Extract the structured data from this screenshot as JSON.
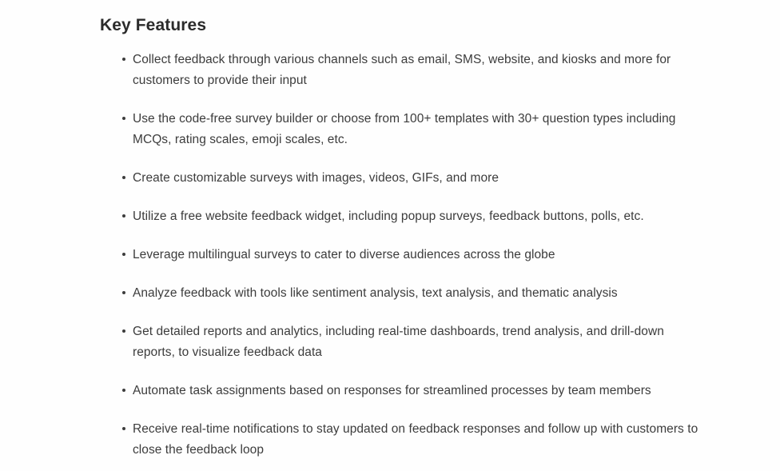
{
  "document": {
    "background_color": "#fefefe",
    "text_color": "#3c3c3c",
    "heading_color": "#2b2b2b"
  },
  "section": {
    "title": "Key Features",
    "bullet_glyph": "•",
    "features": [
      {
        "text": "Collect feedback through various channels such as email, SMS, website, and kiosks and more for customers to provide their input"
      },
      {
        "text": "Use the code-free survey builder or choose from 100+ templates with 30+ question types including MCQs, rating scales, emoji scales, etc."
      },
      {
        "text": "Create customizable surveys with images, videos, GIFs, and more"
      },
      {
        "text": "Utilize a free website feedback widget, including popup surveys, feedback buttons, polls, etc."
      },
      {
        "text": "Leverage multilingual surveys to cater to diverse audiences across the globe"
      },
      {
        "text": "Analyze feedback with tools like sentiment analysis, text analysis, and thematic analysis"
      },
      {
        "text": "Get detailed reports and analytics, including real-time dashboards, trend analysis, and drill-down reports, to visualize feedback data"
      },
      {
        "text": "Automate task assignments based on responses for streamlined processes by team members"
      },
      {
        "text": "Receive real-time notifications to stay updated on feedback responses and follow up with customers to close the feedback loop"
      }
    ]
  }
}
